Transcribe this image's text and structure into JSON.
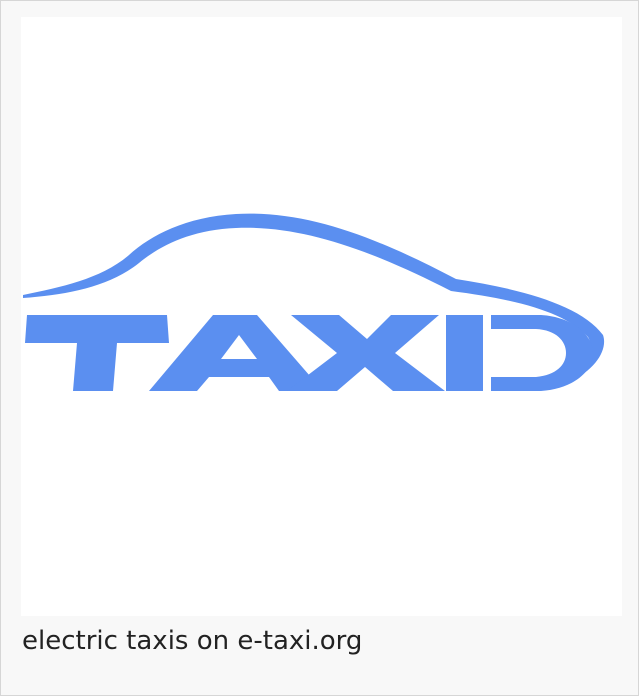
{
  "logo": {
    "wordmark": "TAXI",
    "color": "#5b8ff0"
  },
  "caption": {
    "text": "electric taxis on e-taxi.org"
  }
}
